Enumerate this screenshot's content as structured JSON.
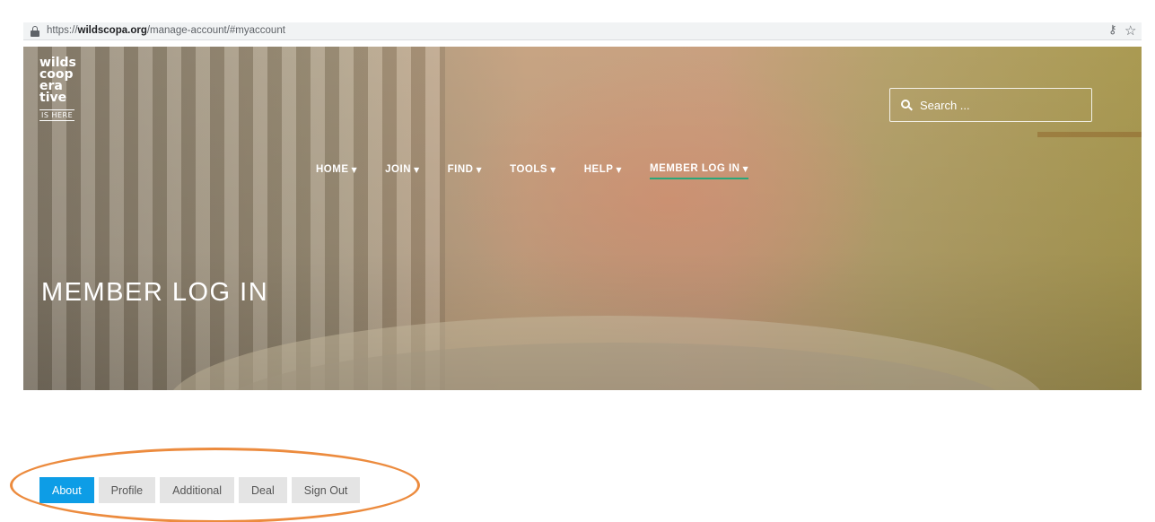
{
  "browser": {
    "url_scheme": "https://",
    "url_host": "wildscopa.org",
    "url_path": "/manage-account/#myaccount",
    "icons": [
      "lock-icon",
      "key-icon",
      "star-icon"
    ]
  },
  "site": {
    "logo_lines": [
      "wilds",
      "coop",
      "era",
      "tive"
    ],
    "logo_tagline": "IS HERE",
    "search_placeholder": "Search ...",
    "nav": [
      {
        "label": "HOME"
      },
      {
        "label": "JOIN"
      },
      {
        "label": "FIND"
      },
      {
        "label": "TOOLS"
      },
      {
        "label": "HELP"
      },
      {
        "label": "MEMBER LOG IN"
      }
    ],
    "hero_title": "MEMBER LOG IN"
  },
  "account_tabs": [
    {
      "label": "About"
    },
    {
      "label": "Profile"
    },
    {
      "label": "Additional"
    },
    {
      "label": "Deal"
    },
    {
      "label": "Sign Out"
    }
  ],
  "colors": {
    "active_tab": "#0d9de6",
    "nav_active_underline": "#29a77a",
    "highlight_ellipse": "#ec8b3e"
  }
}
